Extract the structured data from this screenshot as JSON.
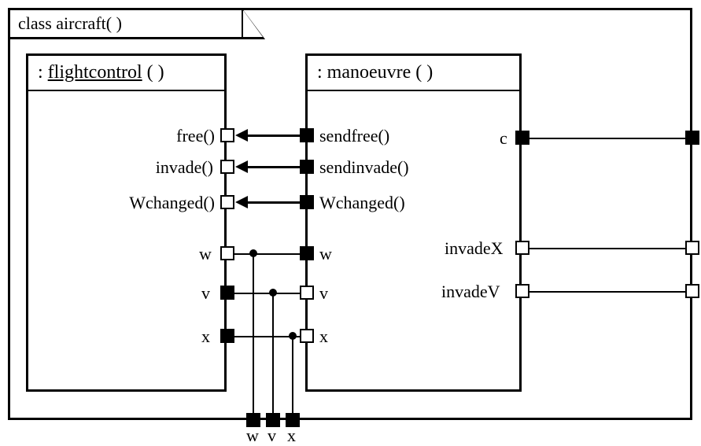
{
  "chart_data": {
    "type": "diagram",
    "title": "class aircraft( )",
    "components": [
      {
        "name": "flightcontrol",
        "header": ": flightcontrol ( )",
        "ports_right": [
          {
            "label": "free()",
            "filled": false
          },
          {
            "label": "invade()",
            "filled": false
          },
          {
            "label": "Wchanged()",
            "filled": false
          },
          {
            "label": "w",
            "filled": false
          },
          {
            "label": "v",
            "filled": true
          },
          {
            "label": "x",
            "filled": true
          }
        ]
      },
      {
        "name": "manoeuvre",
        "header": ": manoeuvre ( )",
        "ports_left": [
          {
            "label": "sendfree()",
            "filled": true
          },
          {
            "label": "sendinvade()",
            "filled": true
          },
          {
            "label": "Wchanged()",
            "filled": true
          },
          {
            "label": "w",
            "filled": true
          },
          {
            "label": "v",
            "filled": false
          },
          {
            "label": "x",
            "filled": false
          }
        ],
        "ports_right": [
          {
            "label": "c",
            "filled": true
          },
          {
            "label": "invadeX",
            "filled": false
          },
          {
            "label": "invadeV",
            "filled": false
          }
        ]
      }
    ],
    "outer_ports_right": [
      {
        "label": "c",
        "filled": true
      },
      {
        "label": "invadeX",
        "filled": false
      },
      {
        "label": "invadeV",
        "filled": false
      }
    ],
    "outer_ports_bottom": [
      {
        "label": "w",
        "filled": true
      },
      {
        "label": "v",
        "filled": true
      },
      {
        "label": "x",
        "filled": true
      }
    ],
    "connections": [
      {
        "from": "manoeuvre.sendfree",
        "to": "flightcontrol.free",
        "type": "arrow"
      },
      {
        "from": "manoeuvre.sendinvade",
        "to": "flightcontrol.invade",
        "type": "arrow"
      },
      {
        "from": "manoeuvre.Wchanged",
        "to": "flightcontrol.Wchanged",
        "type": "arrow"
      },
      {
        "from": "flightcontrol.w",
        "to": "manoeuvre.w",
        "type": "line",
        "junction_to_bottom": "w"
      },
      {
        "from": "flightcontrol.v",
        "to": "manoeuvre.v",
        "type": "line",
        "junction_to_bottom": "v"
      },
      {
        "from": "flightcontrol.x",
        "to": "manoeuvre.x",
        "type": "line",
        "junction_to_bottom": "x"
      },
      {
        "from": "manoeuvre.c",
        "to": "outer.c",
        "type": "line"
      },
      {
        "from": "manoeuvre.invadeX",
        "to": "outer.invadeX",
        "type": "line"
      },
      {
        "from": "manoeuvre.invadeV",
        "to": "outer.invadeV",
        "type": "line"
      }
    ]
  },
  "labels": {
    "class_title": "class aircraft( )",
    "flightcontrol_header": ": flightcontrol ( )",
    "manoeuvre_header": ": manoeuvre ( )",
    "free": "free()",
    "invade": "invade()",
    "wchanged": "Wchanged()",
    "sendfree": "sendfree()",
    "sendinvade": "sendinvade()",
    "w": "w",
    "v": "v",
    "x": "x",
    "c": "c",
    "invadeX": "invadeX",
    "invadeV": "invadeV"
  }
}
